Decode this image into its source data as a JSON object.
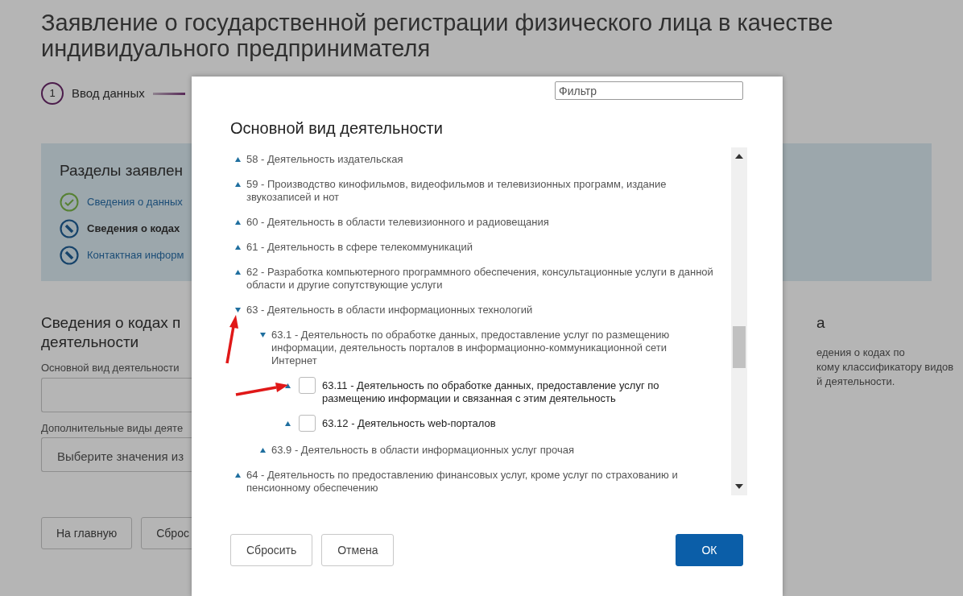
{
  "page": {
    "title": "Заявление о государственной регистрации физического лица в качестве индивидуального предпринимателя",
    "step": {
      "number": "1",
      "label": "Ввод данных"
    },
    "sections_panel": {
      "title": "Разделы заявлен",
      "items": [
        {
          "label": "Сведения о данных",
          "completed": true,
          "current": false
        },
        {
          "label": "Сведения о кодах",
          "completed": false,
          "current": true
        },
        {
          "label": "Контактная информ",
          "completed": false,
          "current": false
        }
      ]
    },
    "form": {
      "heading_lines": [
        "Сведения о кодах п",
        "деятельности"
      ],
      "fields": [
        {
          "label": "Основной вид деятельности"
        },
        {
          "label": "Дополнительные виды деяте",
          "placeholder": "Выберите значения из"
        }
      ],
      "buttons": [
        "На главную",
        "Сброс"
      ]
    },
    "help": {
      "heading": "а",
      "lines": [
        "едения о кодах по",
        "кому классификатору видов",
        "й деятельности."
      ]
    }
  },
  "modal": {
    "filter": {
      "placeholder": "Фильтр"
    },
    "title": "Основной вид деятельности",
    "tree": [
      {
        "label": "58 - Деятельность издательская",
        "expanded": false
      },
      {
        "label": "59 - Производство кинофильмов, видеофильмов и телевизионных программ, издание звукозаписей и нот",
        "expanded": false
      },
      {
        "label": "60 - Деятельность в области телевизионного и радиовещания",
        "expanded": false
      },
      {
        "label": "61 - Деятельность в сфере телекоммуникаций",
        "expanded": false
      },
      {
        "label": "62 - Разработка компьютерного программного обеспечения, консультационные услуги в данной области и другие сопутствующие услуги",
        "expanded": false
      },
      {
        "label": "63 - Деятельность в области информационных технологий",
        "expanded": true,
        "children": [
          {
            "label": "63.1 - Деятельность по обработке данных, предоставление услуг по размещению информации, деятельность порталов в информационно-коммуникационной сети Интернет",
            "expanded": true,
            "children": [
              {
                "label": "63.11 - Деятельность по обработке данных, предоставление услуг по размещению информации и связанная с этим деятельность",
                "expanded": false,
                "kind": "checkbox",
                "checked": false
              },
              {
                "label": "63.12 - Деятельность web-порталов",
                "expanded": false,
                "kind": "checkbox",
                "checked": false
              }
            ]
          },
          {
            "label": "63.9 - Деятельность в области информационных услуг прочая",
            "expanded": false
          }
        ]
      },
      {
        "label": "64 - Деятельность по предоставлению финансовых услуг, кроме услуг по страхованию и пенсионному обеспечению",
        "expanded": false
      }
    ],
    "buttons": [
      {
        "label": "Сбросить",
        "kind": "secondary"
      },
      {
        "label": "Отмена",
        "kind": "secondary"
      },
      {
        "label": "ОК",
        "kind": "primary"
      }
    ]
  }
}
